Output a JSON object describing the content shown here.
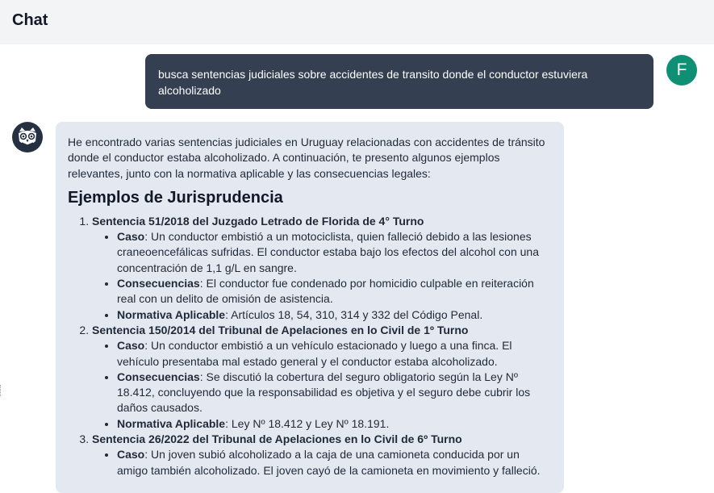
{
  "header": {
    "title": "Chat"
  },
  "user": {
    "avatar_letter": "F",
    "message": "busca sentencias judiciales sobre accidentes de transito donde el conductor estuviera alcoholizado"
  },
  "assistant": {
    "intro": "He encontrado varias sentencias judiciales en Uruguay relacionadas con accidentes de tránsito donde el conductor estaba alcoholizado. A continuación, te presento algunos ejemplos relevantes, junto con la normativa aplicable y las consecuencias legales:",
    "heading": "Ejemplos de Jurisprudencia",
    "cases": [
      {
        "title": "Sentencia 51/2018 del Juzgado Letrado de Florida de 4° Turno",
        "items": [
          {
            "label": "Caso",
            "text": ": Un conductor embistió a un motociclista, quien falleció debido a las lesiones craneoencefálicas sufridas. El conductor estaba bajo los efectos del alcohol con una concentración de 1,1 g/L en sangre."
          },
          {
            "label": "Consecuencias",
            "text": ": El conductor fue condenado por homicidio culpable en reiteración real con un delito de omisión de asistencia."
          },
          {
            "label": "Normativa Aplicable",
            "text": ": Artículos 18, 54, 310, 314 y 332 del Código Penal."
          }
        ]
      },
      {
        "title": "Sentencia 150/2014 del Tribunal de Apelaciones en lo Civil de 1º Turno",
        "items": [
          {
            "label": "Caso",
            "text": ": Un conductor embistió a un vehículo estacionado y luego a una finca. El vehículo presentaba mal estado general y el conductor estaba alcoholizado."
          },
          {
            "label": "Consecuencias",
            "text": ": Se discutió la cobertura del seguro obligatorio según la Ley Nº 18.412, concluyendo que la responsabilidad es objetiva y el seguro debe cubrir los daños causados."
          },
          {
            "label": "Normativa Aplicable",
            "text": ": Ley Nº 18.412 y Ley Nº 18.191."
          }
        ]
      },
      {
        "title": "Sentencia 26/2022 del Tribunal de Apelaciones en lo Civil de 6º Turno",
        "items": [
          {
            "label": "Caso",
            "text": ": Un joven subió alcoholizado a la caja de una camioneta conducida por un amigo también alcoholizado. El joven cayó de la camioneta en movimiento y falleció."
          }
        ]
      }
    ]
  },
  "colors": {
    "header_bg": "#f3f4f6",
    "user_bubble": "#343f52",
    "user_avatar": "#0f8f73",
    "assistant_bubble": "#e4e9f1",
    "assistant_avatar": "#253041"
  },
  "icons": {
    "assistant_avatar": "owl-icon"
  }
}
